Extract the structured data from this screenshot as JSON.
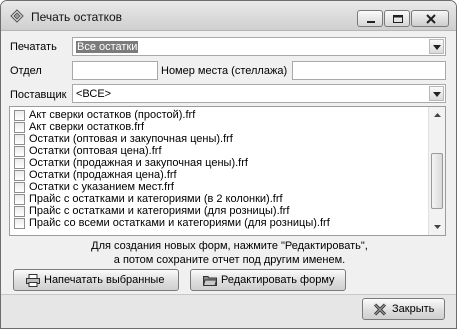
{
  "window": {
    "title": "Печать остатков"
  },
  "form": {
    "print_label": "Печатать",
    "print_value": "Все остатки",
    "dept_label": "Отдел",
    "dept_value": "",
    "place_label": "Номер места (стеллажа)",
    "place_value": "",
    "supplier_label": "Поставщик",
    "supplier_value": "<ВСЕ>"
  },
  "reports": {
    "items": [
      {
        "label": "Акт сверки остатков (простой).frf",
        "checked": false
      },
      {
        "label": "Акт сверки остатков.frf",
        "checked": false
      },
      {
        "label": "Остатки (оптовая и закупочная цены).frf",
        "checked": false
      },
      {
        "label": "Остатки (оптовая цена).frf",
        "checked": false
      },
      {
        "label": "Остатки (продажная и закупочная цены).frf",
        "checked": false
      },
      {
        "label": "Остатки (продажная цена).frf",
        "checked": false
      },
      {
        "label": "Остатки с указанием мест.frf",
        "checked": false
      },
      {
        "label": "Прайс с остатками и категориями (в 2 колонки).frf",
        "checked": false
      },
      {
        "label": "Прайс с остатками и категориями (для розницы).frf",
        "checked": false
      },
      {
        "label": "Прайс со всеми остатками и категориями (для розницы).frf",
        "checked": false
      }
    ]
  },
  "hint": {
    "line1": "Для создания новых форм, нажмите \"Редактировать\",",
    "line2": "а потом сохраните отчет под другим именем."
  },
  "buttons": {
    "print_selected": "Напечатать выбранные",
    "edit_form": "Редактировать форму",
    "close": "Закрыть"
  }
}
